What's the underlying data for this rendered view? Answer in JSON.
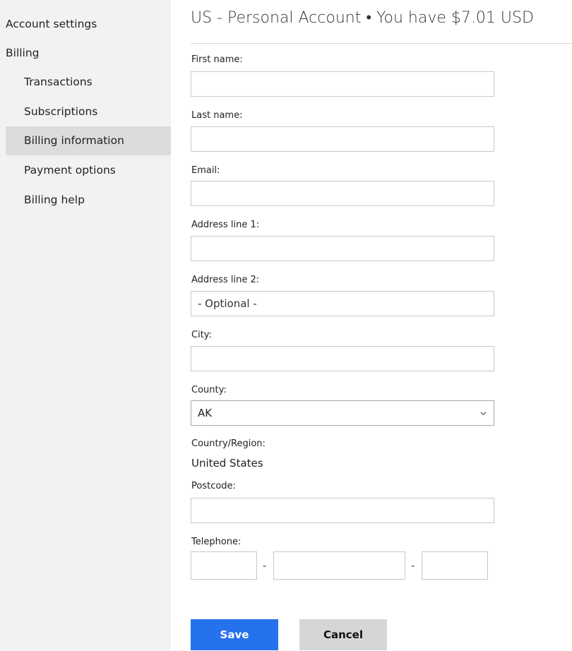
{
  "sidebar": {
    "items": [
      {
        "label": "Account settings"
      },
      {
        "label": "Billing"
      },
      {
        "label": "Transactions"
      },
      {
        "label": "Subscriptions"
      },
      {
        "label": "Billing information"
      },
      {
        "label": "Payment options"
      },
      {
        "label": "Billing help"
      }
    ]
  },
  "header": {
    "title": "US - Personal Account • You have $7.01 USD"
  },
  "form": {
    "first_name": {
      "label": "First name:",
      "value": ""
    },
    "last_name": {
      "label": "Last name:",
      "value": ""
    },
    "email": {
      "label": "Email:",
      "value": ""
    },
    "address1": {
      "label": "Address line 1:",
      "value": ""
    },
    "address2": {
      "label": "Address line 2:",
      "value": "- Optional -"
    },
    "city": {
      "label": "City:",
      "value": ""
    },
    "county": {
      "label": "County:",
      "selected": "AK"
    },
    "country": {
      "label": "Country/Region:",
      "value": "United States"
    },
    "postcode": {
      "label": "Postcode:",
      "value": ""
    },
    "telephone": {
      "label": "Telephone:",
      "separator": "-"
    }
  },
  "buttons": {
    "save": "Save",
    "cancel": "Cancel"
  },
  "colors": {
    "accent": "#2672ec",
    "sidebar_bg": "#f2f2f2",
    "active_bg": "#dcdcdc"
  }
}
